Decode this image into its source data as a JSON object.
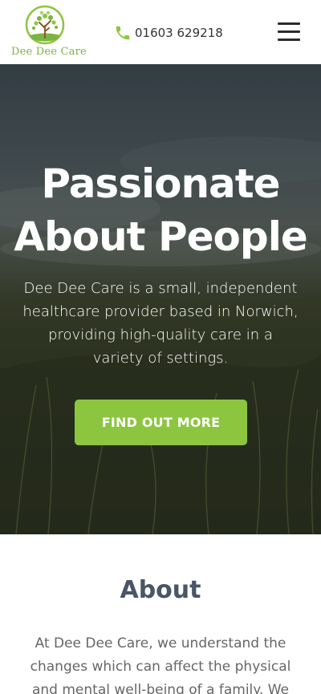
{
  "header": {
    "logo_text": "Dee Dee Care",
    "phone_number": "01603 629218",
    "phone_icon": "phone-icon",
    "menu_icon": "hamburger-menu-icon"
  },
  "hero": {
    "title_line1": "Passionate",
    "title_line2": "About People",
    "description": "Dee Dee Care is a small, independent healthcare provider based in Norwich, providing high-quality care in a variety of settings.",
    "button_label": "FIND OUT MORE"
  },
  "about": {
    "title": "About",
    "text": "At Dee Dee Care, we understand the changes which can affect the physical and mental well-being of a family. We value the"
  },
  "colors": {
    "brand_green": "#8cc63f",
    "logo_green": "#7cb342",
    "heading": "#4a5566",
    "body_text": "#666666"
  }
}
